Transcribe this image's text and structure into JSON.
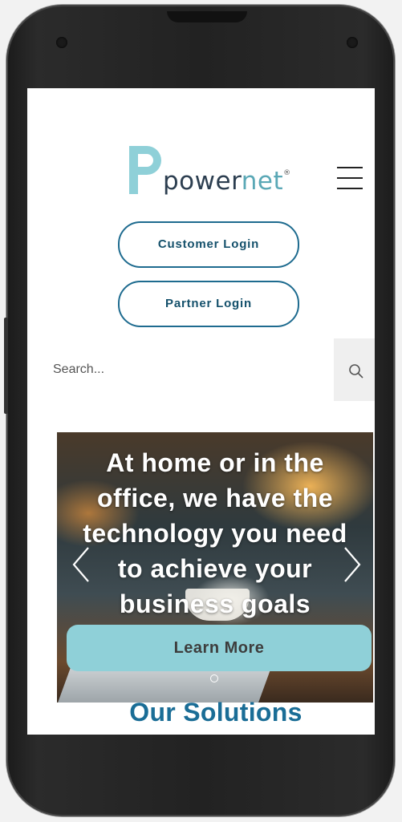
{
  "brand": {
    "logo_text_a": "power",
    "logo_text_b": "net",
    "logo_registered": "®",
    "primary_color": "#1e6b8f",
    "accent_color": "#5aa8b6"
  },
  "header": {
    "menu_icon": "hamburger-menu-icon"
  },
  "auth": {
    "customer_login": "Customer Login",
    "partner_login": "Partner Login"
  },
  "search": {
    "placeholder": "Search...",
    "icon": "search-icon"
  },
  "hero": {
    "headline": "At home or in the office, we have the technology you need to achieve your business goals",
    "cta": "Learn More",
    "cta_color": "#8fd0d8",
    "prev_icon": "chevron-left-icon",
    "next_icon": "chevron-right-icon"
  },
  "solutions": {
    "title": "Our Solutions"
  }
}
